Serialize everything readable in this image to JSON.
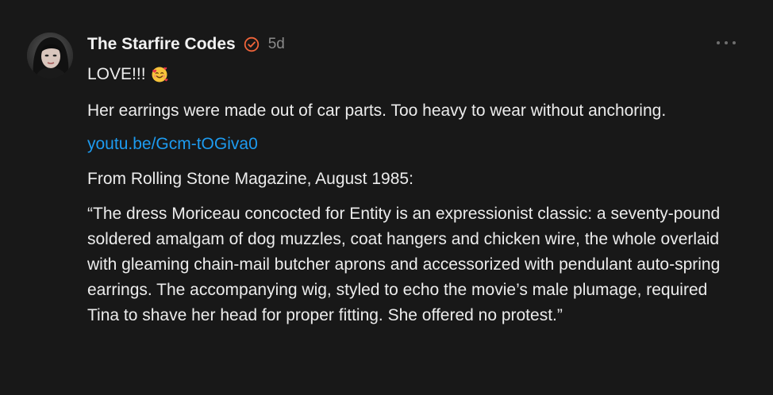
{
  "comment": {
    "author": "The Starfire Codes",
    "timestamp": "5d",
    "verified_icon": "verified-badge-icon",
    "more_icon": "more-options-icon",
    "accent_color": "#f0643a",
    "link_color": "#1d9bf0",
    "line1": "LOVE!!!",
    "line1_emoji": "smiling-face-with-hearts-icon",
    "paragraph_earrings": "Her earrings were made out of car parts. Too heavy to wear without anchoring.",
    "link": "youtu.be/Gcm-tOGiva0",
    "paragraph_source": "From Rolling Stone Magazine, August 1985:",
    "paragraph_quote": "“The dress Moriceau concocted for Entity is an expressionist classic: a seventy-pound soldered amalgam of dog muzzles, coat hangers and chicken wire, the whole overlaid with gleaming chain-mail butcher aprons and accessorized with pendulant auto-spring earrings. The accompanying wig, styled to echo the movie’s male plumage, required Tina to shave her head for proper fitting. She offered no protest.”"
  }
}
